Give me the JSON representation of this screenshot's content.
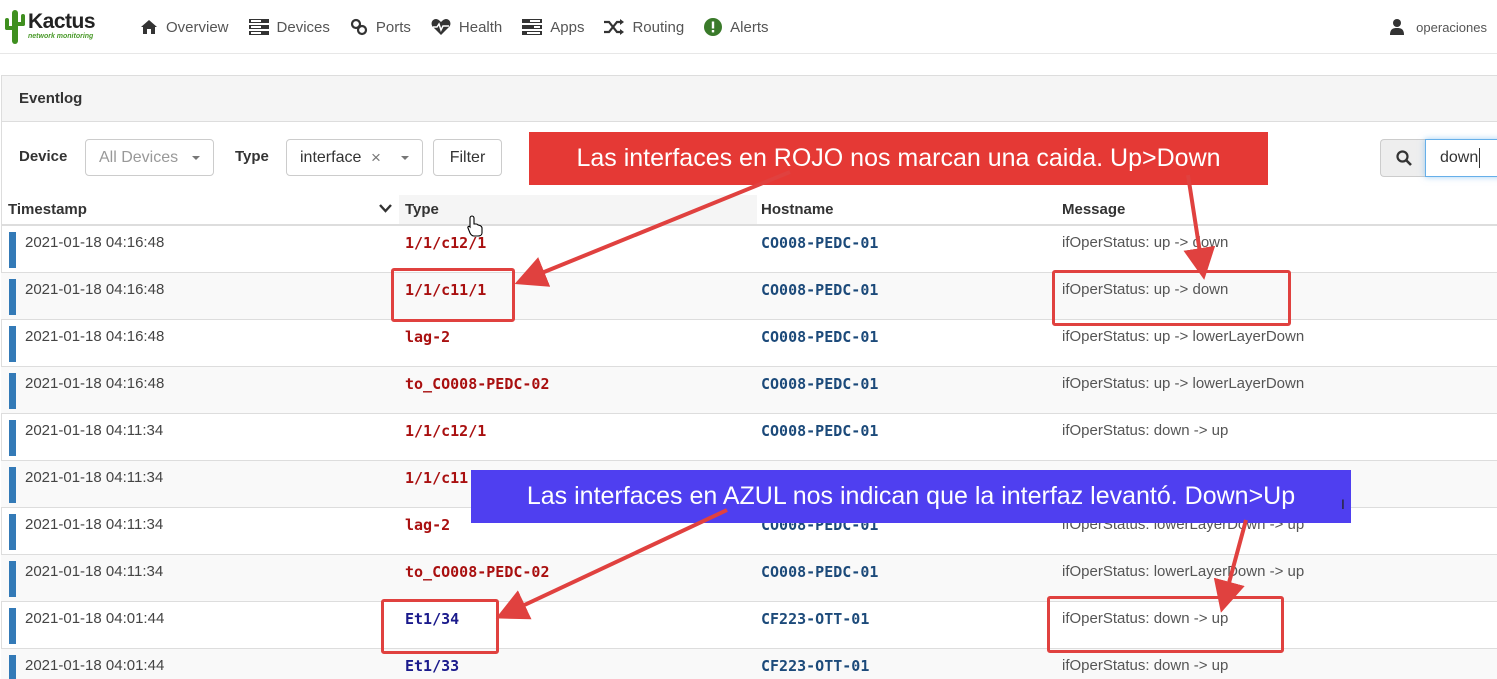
{
  "app": {
    "brand": "Kactus",
    "tagline": "network monitoring"
  },
  "nav": {
    "items": [
      {
        "label": "Overview",
        "icon": "home-icon"
      },
      {
        "label": "Devices",
        "icon": "server-icon"
      },
      {
        "label": "Ports",
        "icon": "link-icon"
      },
      {
        "label": "Health",
        "icon": "heartbeat-icon"
      },
      {
        "label": "Apps",
        "icon": "tasks-icon"
      },
      {
        "label": "Routing",
        "icon": "random-icon"
      },
      {
        "label": "Alerts",
        "icon": "exclamation-circle-icon"
      }
    ],
    "user": "operaciones"
  },
  "panel": {
    "title": "Eventlog"
  },
  "filters": {
    "device_label": "Device",
    "device_value": "All Devices",
    "type_label": "Type",
    "type_value": "interface",
    "filter_button": "Filter",
    "search_value": "down"
  },
  "table": {
    "columns": [
      "Timestamp",
      "Type",
      "Hostname",
      "Message"
    ],
    "rows": [
      {
        "timestamp": "2021-01-18 04:16:48",
        "type": "1/1/c12/1",
        "type_color": "#a91010",
        "hostname": "CO008-PEDC-01",
        "message": "ifOperStatus: up -> down"
      },
      {
        "timestamp": "2021-01-18 04:16:48",
        "type": "1/1/c11/1",
        "type_color": "#a91010",
        "hostname": "CO008-PEDC-01",
        "message": "ifOperStatus: up -> down"
      },
      {
        "timestamp": "2021-01-18 04:16:48",
        "type": "lag-2",
        "type_color": "#a91010",
        "hostname": "CO008-PEDC-01",
        "message": "ifOperStatus: up -> lowerLayerDown"
      },
      {
        "timestamp": "2021-01-18 04:16:48",
        "type": "to_CO008-PEDC-02",
        "type_color": "#a91010",
        "hostname": "CO008-PEDC-01",
        "message": "ifOperStatus: up -> lowerLayerDown"
      },
      {
        "timestamp": "2021-01-18 04:11:34",
        "type": "1/1/c12/1",
        "type_color": "#a91010",
        "hostname": "CO008-PEDC-01",
        "message": "ifOperStatus: down -> up"
      },
      {
        "timestamp": "2021-01-18 04:11:34",
        "type": "1/1/c11",
        "type_color": "#a91010",
        "hostname": "",
        "message": ""
      },
      {
        "timestamp": "2021-01-18 04:11:34",
        "type": "lag-2",
        "type_color": "#a91010",
        "hostname": "CO008-PEDC-01",
        "message": "ifOperStatus: lowerLayerDown -> up"
      },
      {
        "timestamp": "2021-01-18 04:11:34",
        "type": "to_CO008-PEDC-02",
        "type_color": "#a91010",
        "hostname": "CO008-PEDC-01",
        "message": "ifOperStatus: lowerLayerDown -> up"
      },
      {
        "timestamp": "2021-01-18 04:01:44",
        "type": "Et1/34",
        "type_color": "#1a1a8c",
        "hostname": "CF223-OTT-01",
        "message": "ifOperStatus: down -> up"
      },
      {
        "timestamp": "2021-01-18 04:01:44",
        "type": "Et1/33",
        "type_color": "#1a1a8c",
        "hostname": "CF223-OTT-01",
        "message": "ifOperStatus: down -> up"
      }
    ]
  },
  "annotations": {
    "red_note": "Las interfaces en ROJO nos marcan una caida. Up>Down",
    "blue_note": "Las interfaces en AZUL nos indican que la interfaz levantó. Down>Up",
    "red_color": "#e53935",
    "blue_color": "#4f3ff0",
    "highlight_color": "#e0413f"
  },
  "colors": {
    "hostname": "#1c4a7a",
    "row_bar": "#337ab7"
  }
}
